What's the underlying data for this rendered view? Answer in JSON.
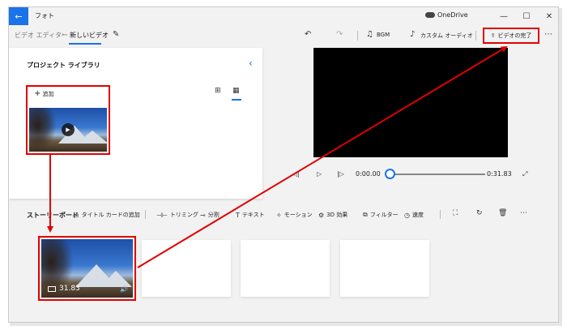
{
  "window": {
    "app_title": "フォト",
    "onedrive_label": "OneDrive",
    "back_icon": "←",
    "minimize_icon": "—",
    "maximize_icon": "☐",
    "close_icon": "✕"
  },
  "toolbar": {
    "breadcrumb_parent": "ビデオ エディター",
    "breadcrumb_separator": "›",
    "breadcrumb_current": "新しいビデオ",
    "edit_icon": "✎",
    "undo_icon": "↶",
    "redo_icon": "↷",
    "bgm_icon": "♫",
    "bgm_label": "BGM",
    "custom_audio_icon": "♪",
    "custom_audio_label": "カスタム オーディオ",
    "finish_icon": "⇪",
    "finish_label": "ビデオの完了",
    "more_icon": "⋯"
  },
  "library": {
    "title": "プロジェクト ライブラリ",
    "collapse_icon": "‹",
    "add_icon": "+",
    "add_label": "追加",
    "view_icon_1": "⊞",
    "view_icon_2": "▦",
    "play_icon": "▶"
  },
  "preview": {
    "prev_frame_icon": "◁|",
    "play_icon": "▷",
    "next_frame_icon": "|▷",
    "current_time": "0:00.00",
    "total_time": "0:31.83",
    "fullscreen_icon": "⤢",
    "progress": 0.0
  },
  "storyboard": {
    "title": "ストーリーボード",
    "tools": [
      {
        "icon": "▭",
        "label": "タイトル カードの追加"
      },
      {
        "icon": "⊣⊢",
        "label": "トリミング"
      },
      {
        "icon": "⊸",
        "label": "分割"
      },
      {
        "icon": "T",
        "label": "テキスト"
      },
      {
        "icon": "✧",
        "label": "モーション"
      },
      {
        "icon": "⚙",
        "label": "3D 効果"
      },
      {
        "icon": "⧉",
        "label": "フィルター"
      },
      {
        "icon": "◷",
        "label": "速度"
      }
    ],
    "resize_icon": "⛶",
    "rotate_icon": "↻",
    "delete_icon": "🗑",
    "more_icon": "⋯",
    "clip_duration": "31.83",
    "clip_volume_icon": "🔊"
  },
  "colors": {
    "accent": "#1a73e8",
    "highlight": "#e00000"
  }
}
